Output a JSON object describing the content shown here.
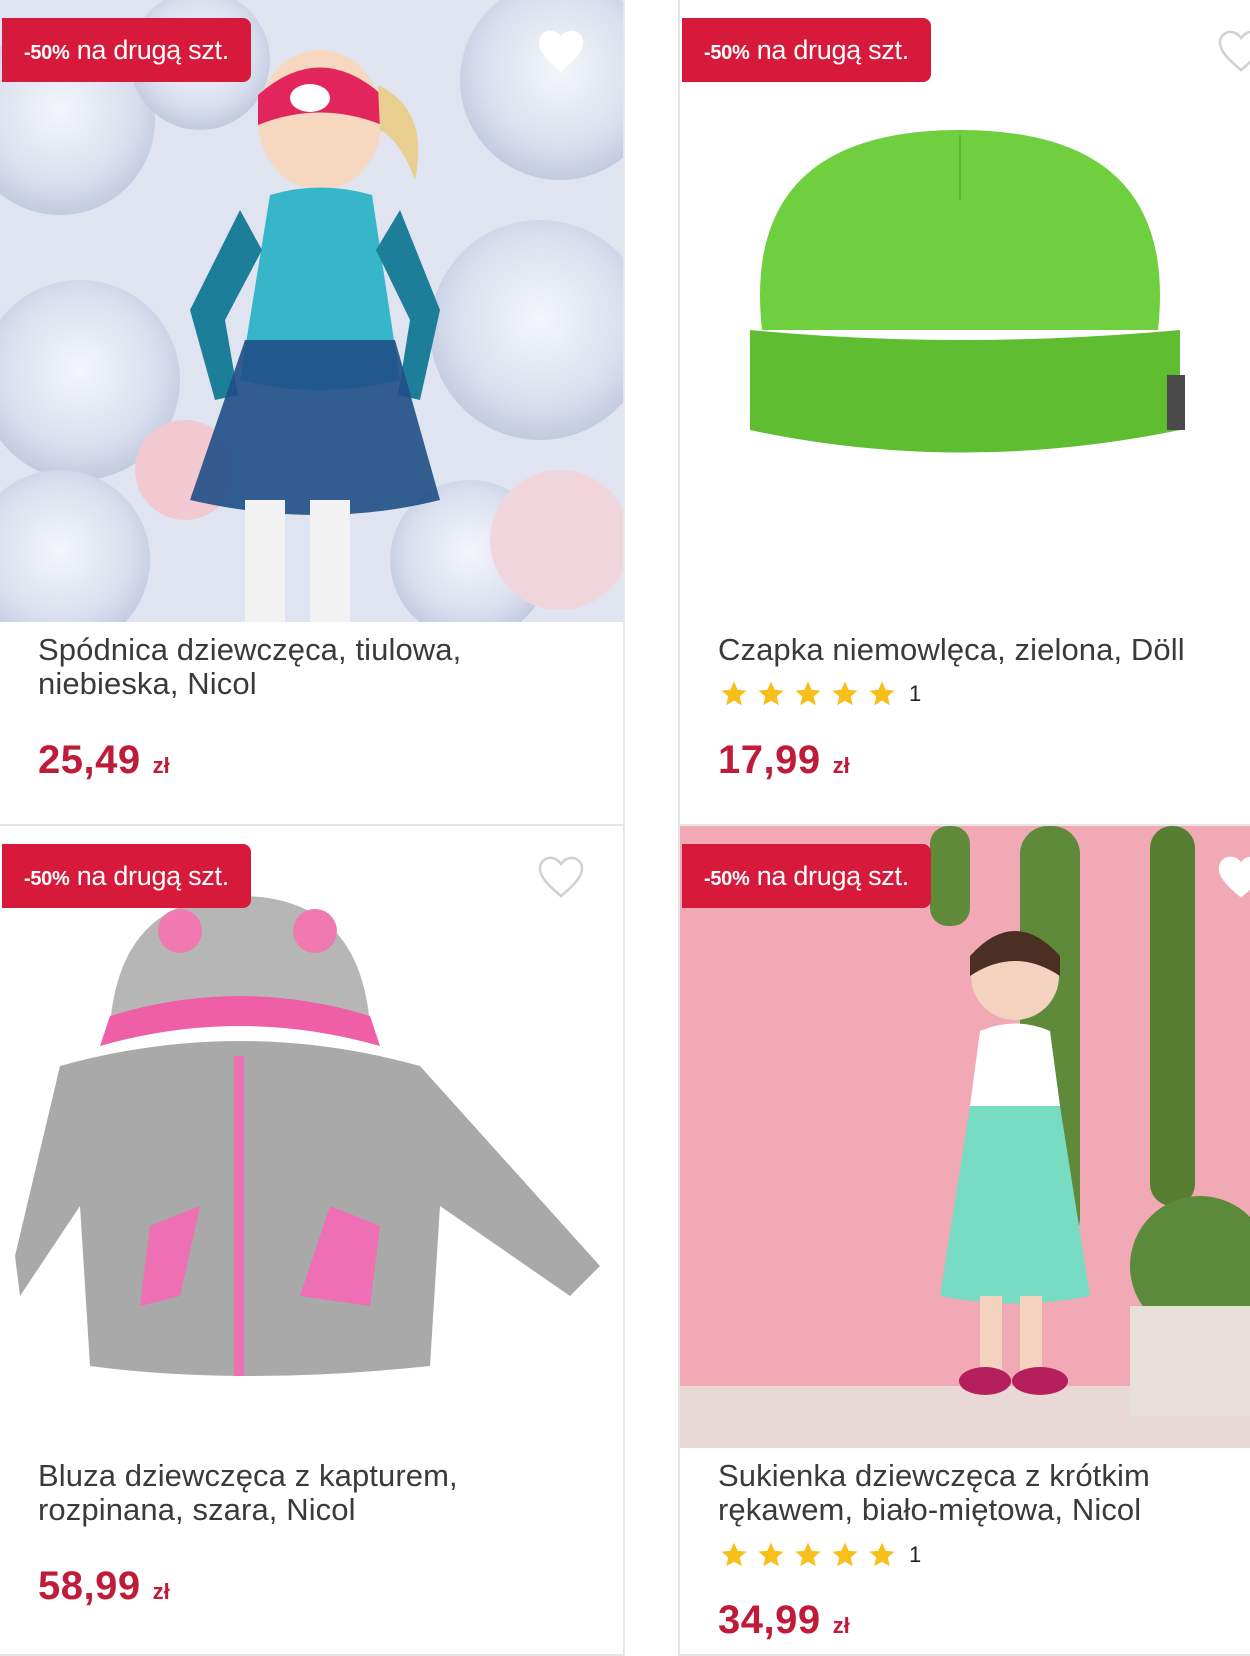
{
  "products": [
    {
      "badge_pct": "-50%",
      "badge_text": "na drugą szt.",
      "title": "Spódnica dziewczęca, tiulowa, niebieska, Nicol",
      "price": "25,49",
      "currency": "zł",
      "favorite_icon": "heart-outline-icon"
    },
    {
      "badge_pct": "-50%",
      "badge_text": "na drugą szt.",
      "title": "Czapka niemowlęca, zielona, Döll",
      "rating_count": "1",
      "price": "17,99",
      "currency": "zł",
      "favorite_icon": "heart-outline-icon"
    },
    {
      "badge_pct": "-50%",
      "badge_text": "na drugą szt.",
      "title": "Bluza dziewczęca z kapturem, rozpinana, szara, Nicol",
      "price": "58,99",
      "currency": "zł",
      "favorite_icon": "heart-outline-icon"
    },
    {
      "badge_pct": "-50%",
      "badge_text": "na drugą szt.",
      "title": "Sukienka dziewczęca z krótkim rękawem, biało-miętowa, Nicol",
      "rating_count": "1",
      "price": "34,99",
      "currency": "zł",
      "favorite_icon": "heart-outline-icon"
    }
  ],
  "colors": {
    "badge": "#d7193b",
    "price": "#bf1c3a",
    "star": "#f6bf1a"
  }
}
